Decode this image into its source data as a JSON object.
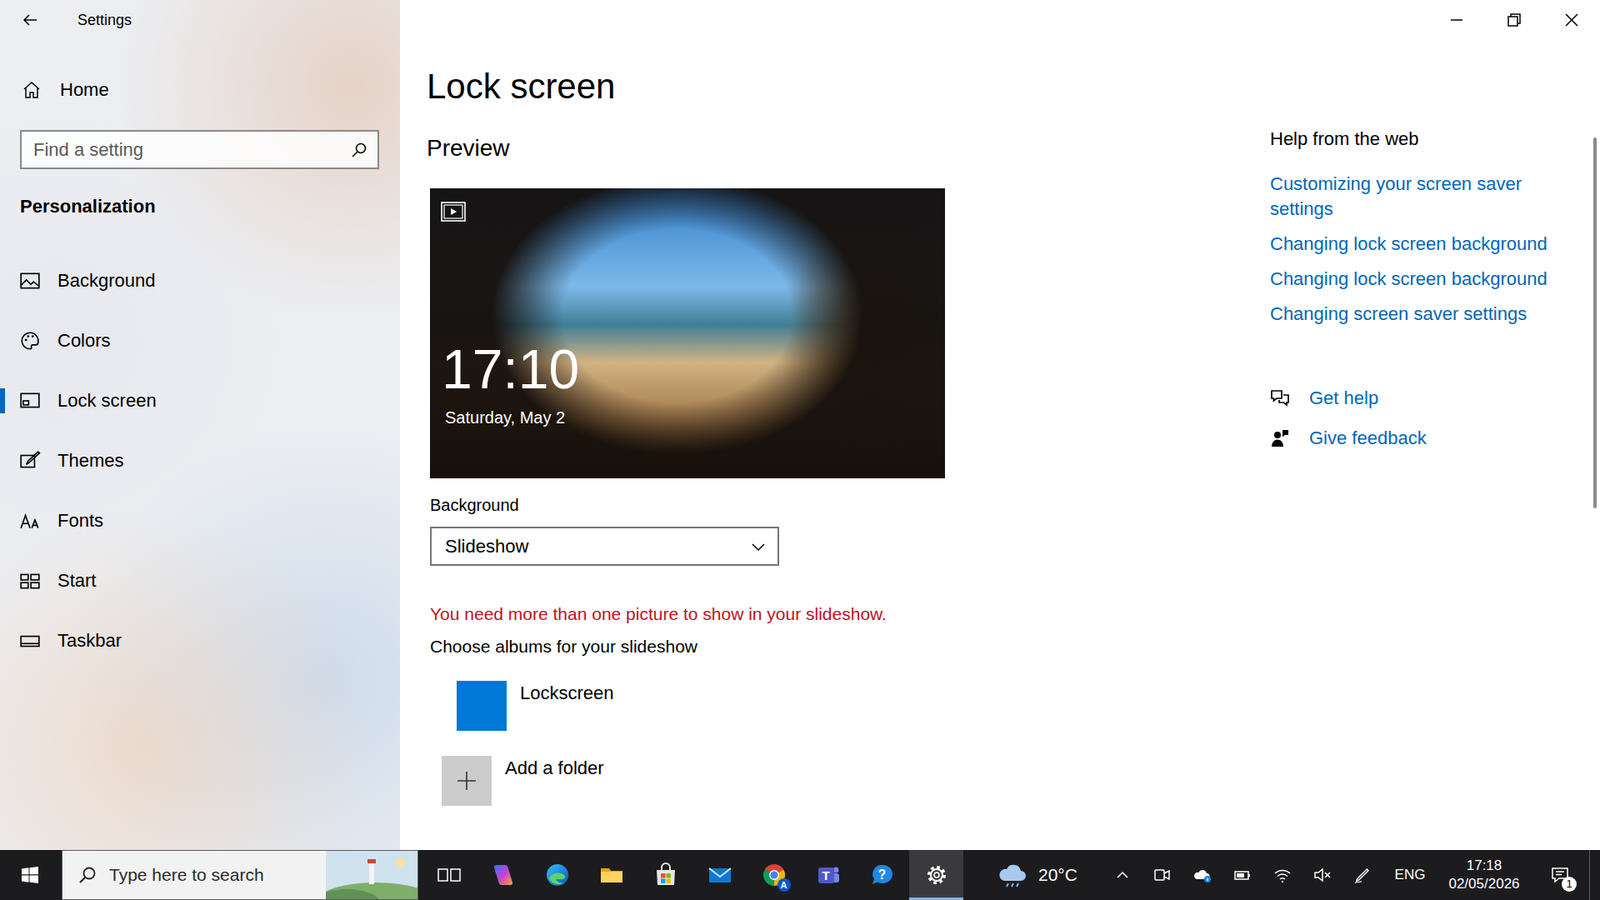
{
  "window": {
    "title": "Settings"
  },
  "sidebar": {
    "home": "Home",
    "search": {
      "placeholder": "Find a setting"
    },
    "section": "Personalization",
    "items": [
      {
        "label": "Background",
        "selected": false
      },
      {
        "label": "Colors",
        "selected": false
      },
      {
        "label": "Lock screen",
        "selected": true
      },
      {
        "label": "Themes",
        "selected": false
      },
      {
        "label": "Fonts",
        "selected": false
      },
      {
        "label": "Start",
        "selected": false
      },
      {
        "label": "Taskbar",
        "selected": false
      }
    ]
  },
  "page": {
    "title": "Lock screen",
    "preview": {
      "heading": "Preview",
      "time": "17:10",
      "date": "Saturday, May 2"
    },
    "background": {
      "label": "Background",
      "value": "Slideshow"
    },
    "error": "You need more than one picture to show in your slideshow.",
    "albums": {
      "heading": "Choose albums for your slideshow",
      "items": [
        {
          "label": "Lockscreen",
          "kind": "album"
        },
        {
          "label": "Add a folder",
          "kind": "add"
        }
      ]
    }
  },
  "help": {
    "heading": "Help from the web",
    "links": [
      "Customizing your screen saver settings",
      "Changing lock screen background",
      "Changing lock screen background",
      "Changing screen saver settings"
    ],
    "actions": [
      "Get help",
      "Give feedback"
    ]
  },
  "taskbar": {
    "search": {
      "placeholder": "Type here to search"
    },
    "apps": [
      {
        "kind": "taskview",
        "active": false
      },
      {
        "kind": "copilot",
        "active": false
      },
      {
        "kind": "edge",
        "active": false
      },
      {
        "kind": "explorer",
        "active": false
      },
      {
        "kind": "store",
        "active": false
      },
      {
        "kind": "mail",
        "active": false
      },
      {
        "kind": "chrome",
        "badge": "A",
        "active": false
      },
      {
        "kind": "teams",
        "glyph": "T",
        "active": false
      },
      {
        "kind": "help",
        "glyph": "?",
        "active": false
      },
      {
        "kind": "settings",
        "active": true
      }
    ],
    "weather": {
      "temperature": "20°C"
    },
    "tray": [
      {
        "kind": "chevron"
      },
      {
        "kind": "meet"
      },
      {
        "kind": "onedrive"
      },
      {
        "kind": "battery"
      },
      {
        "kind": "wifi"
      },
      {
        "kind": "volume",
        "muted": true
      },
      {
        "kind": "pen"
      }
    ],
    "language": "ENG",
    "clock": {
      "time": "17:18",
      "date": "02/05/2026"
    },
    "notifications": {
      "count": "1"
    }
  }
}
